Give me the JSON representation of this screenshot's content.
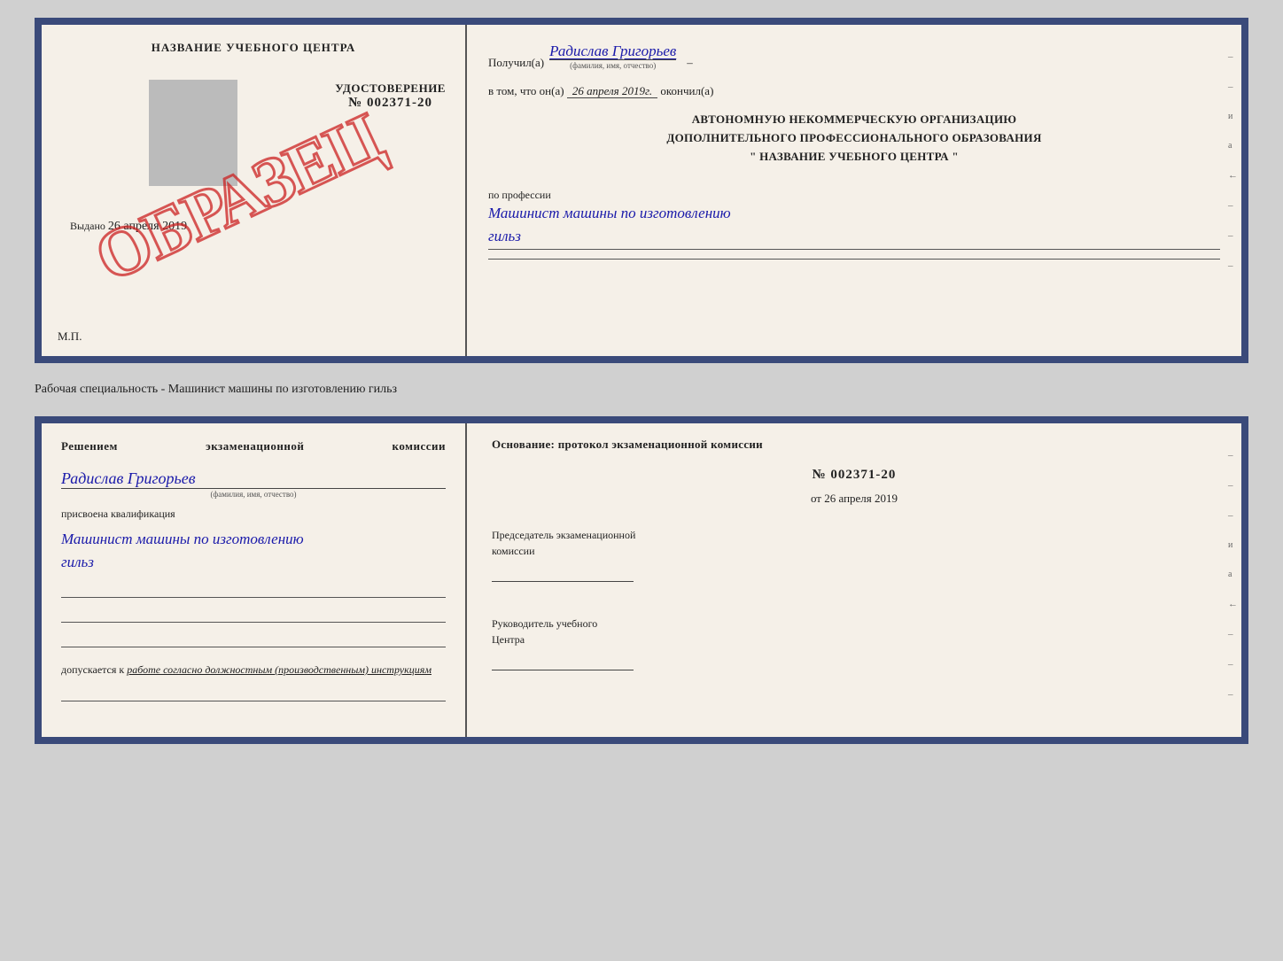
{
  "top_doc": {
    "left": {
      "center_title": "НАЗВАНИЕ УЧЕБНОГО ЦЕНТРА",
      "cert_title": "УДОСТОВЕРЕНИЕ",
      "cert_number": "№ 002371-20",
      "date_label": "Выдано",
      "date_value": "26 апреля 2019",
      "mp": "М.П.",
      "watermark": "ОБРАЗЕЦ"
    },
    "right": {
      "received_label": "Получил(а)",
      "received_name": "Радислав Григорьев",
      "fio_hint": "(фамилия, имя, отчество)",
      "date_prefix": "в том, что он(а)",
      "date_value": "26 апреля 2019г.",
      "date_suffix": "окончил(а)",
      "org_line1": "АВТОНОМНУЮ НЕКОММЕРЧЕСКУЮ ОРГАНИЗАЦИЮ",
      "org_line2": "ДОПОЛНИТЕЛЬНОГО ПРОФЕССИОНАЛЬНОГО ОБРАЗОВАНИЯ",
      "org_line3": "\"  НАЗВАНИЕ УЧЕБНОГО ЦЕНТРА  \"",
      "prof_label": "по профессии",
      "prof_value1": "Машинист машины по изготовлению",
      "prof_value2": "гильз"
    }
  },
  "separator": {
    "text": "Рабочая специальность - Машинист машины по изготовлению гильз"
  },
  "bottom_doc": {
    "left": {
      "decision_title": "Решением  экзаменационной  комиссии",
      "person_name": "Радислав Григорьев",
      "fio_hint": "(фамилия, имя, отчество)",
      "assigned_text": "присвоена квалификация",
      "qualification1": "Машинист машины по изготовлению",
      "qualification2": "гильз",
      "allowed_prefix": "допускается к",
      "allowed_value": "работе согласно должностным (производственным) инструкциям"
    },
    "right": {
      "osnov_title": "Основание: протокол экзаменационной  комиссии",
      "protokol_number": "№  002371-20",
      "date_prefix": "от",
      "date_value": "26 апреля 2019",
      "chairman_label1": "Председатель экзаменационной",
      "chairman_label2": "комиссии",
      "head_label1": "Руководитель учебного",
      "head_label2": "Центра"
    }
  }
}
